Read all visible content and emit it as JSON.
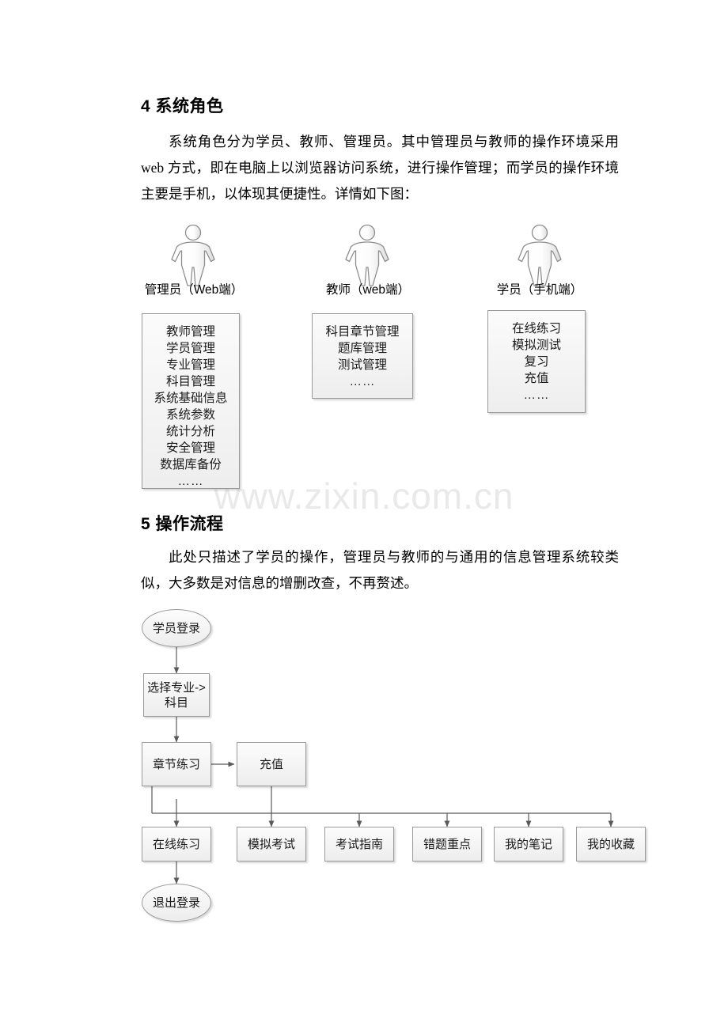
{
  "watermark": "www.zixin.com.cn",
  "sections": {
    "s4": {
      "heading": "4 系统角色",
      "paragraph": "系统角色分为学员、教师、管理员。其中管理员与教师的操作环境采用 web 方式，即在电脑上以浏览器访问系统，进行操作管理；而学员的操作环境主要是手机，以体现其便捷性。详情如下图："
    },
    "s5": {
      "heading": "5 操作流程",
      "paragraph": "此处只描述了学员的操作，管理员与教师的与通用的信息管理系统较类似，大多数是对信息的增删改查，不再赘述。"
    }
  },
  "roles": [
    {
      "actor_label": "管理员（Web端）",
      "features": [
        "教师管理",
        "学员管理",
        "专业管理",
        "科目管理",
        "系统基础信息",
        "系统参数",
        "统计分析",
        "安全管理",
        "数据库备份",
        "……"
      ]
    },
    {
      "actor_label": "教师（web端）",
      "features": [
        "科目章节管理",
        "题库管理",
        "测试管理",
        "……"
      ]
    },
    {
      "actor_label": "学员（手机端）",
      "features": [
        "在线练习",
        "模拟测试",
        "复习",
        "充值",
        "……"
      ]
    }
  ],
  "flow": {
    "login": "学员登录",
    "select": "选择专业->\n科目",
    "chapter": "章节练习",
    "recharge": "充值",
    "branches": [
      "在线练习",
      "模拟考试",
      "考试指南",
      "错题重点",
      "我的笔记",
      "我的收藏"
    ],
    "logout": "退出登录"
  }
}
